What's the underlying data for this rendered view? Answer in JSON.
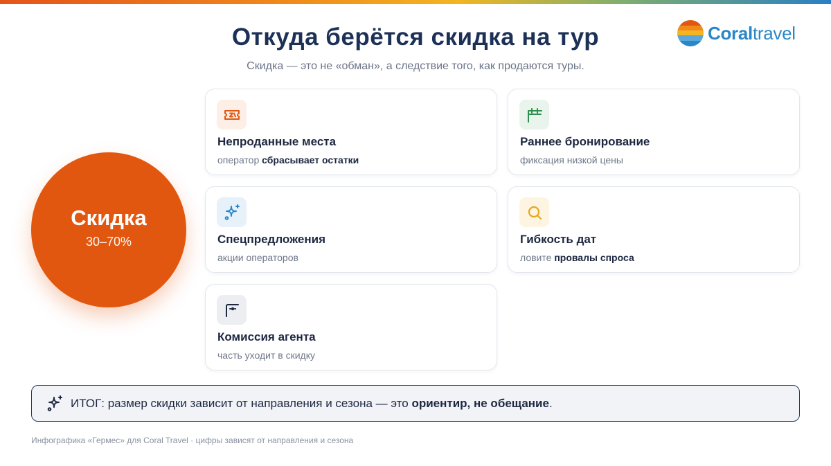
{
  "header": {
    "title": "Откуда берётся скидка на тур",
    "subtitle": "Скидка — это не «обман», а следствие того, как продаются туры."
  },
  "logo": {
    "part1": "Coral",
    "part2": "travel"
  },
  "discount": {
    "label": "Скидка",
    "value": "30–70%"
  },
  "cards": [
    {
      "title": "Непроданные места",
      "desc_plain": "оператор ",
      "desc_bold": "сбрасывает остатки",
      "icon": "ticket-icon",
      "color": "#e2570f",
      "bg": "#fdeee6"
    },
    {
      "title": "Раннее бронирование",
      "desc_plain": "фиксация низкой цены",
      "desc_bold": "",
      "icon": "calendar-icon",
      "color": "#2f8f4e",
      "bg": "#e9f4ec"
    },
    {
      "title": "Спецпредложения",
      "desc_plain": "акции операторов",
      "desc_bold": "",
      "icon": "sparkle-icon",
      "color": "#2a86c8",
      "bg": "#e6f1fa"
    },
    {
      "title": "Гибкость дат",
      "desc_plain": "ловите ",
      "desc_bold": "провалы спроса",
      "icon": "search-icon",
      "color": "#e3a81c",
      "bg": "#fdf5e2"
    },
    {
      "title": "Комиссия агента",
      "desc_plain": "часть уходит в скидку",
      "desc_bold": "",
      "icon": "commission-icon",
      "color": "#1d2740",
      "bg": "#eceef2"
    }
  ],
  "summary": {
    "plain": "ИТОГ: размер скидки зависит от направления и сезона — это ",
    "bold": "ориентир, не обещание",
    "end": "."
  },
  "footer": "Инфографика «Гермес» для Coral Travel · цифры зависят от направления и сезона"
}
